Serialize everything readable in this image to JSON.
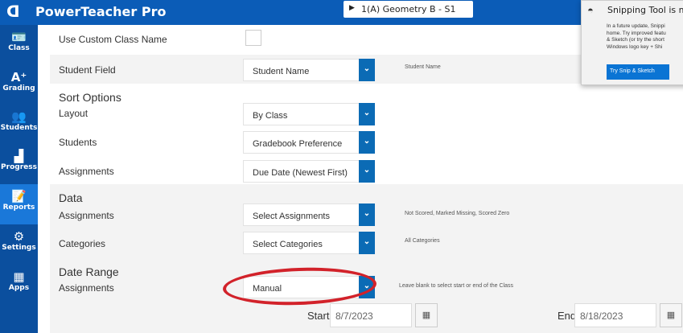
{
  "header": {
    "app_title": "PowerTeacher Pro",
    "class_selector": "1(A) Geometry B - S1"
  },
  "sidebar": {
    "items": [
      {
        "label": "Class",
        "icon": "class-card-icon"
      },
      {
        "label": "Grading",
        "icon": "a-plus-icon"
      },
      {
        "label": "Students",
        "icon": "students-icon"
      },
      {
        "label": "Progress",
        "icon": "bar-chart-icon"
      },
      {
        "label": "Reports",
        "icon": "report-icon",
        "active": true
      },
      {
        "label": "Settings",
        "icon": "gear-icon"
      },
      {
        "label": "Apps",
        "icon": "grid-icon"
      }
    ]
  },
  "form": {
    "custom_class_name": {
      "label": "Use Custom Class Name",
      "checked": false
    },
    "student_field": {
      "label": "Student Field",
      "value": "Student Name",
      "note": "Student Name"
    },
    "sort_options": {
      "title": "Sort Options",
      "layout": {
        "label": "Layout",
        "value": "By Class"
      },
      "students": {
        "label": "Students",
        "value": "Gradebook Preference"
      },
      "assignments": {
        "label": "Assignments",
        "value": "Due Date (Newest First)"
      }
    },
    "data": {
      "title": "Data",
      "assignments": {
        "label": "Assignments",
        "value": "Select Assignments",
        "note": "Not Scored, Marked Missing, Scored Zero"
      },
      "categories": {
        "label": "Categories",
        "value": "Select Categories",
        "note": "All Categories"
      }
    },
    "date_range": {
      "title": "Date Range",
      "assignments": {
        "label": "Assignments",
        "value": "Manual",
        "note": "Leave blank to select start or end of the Class"
      },
      "start_label": "Start",
      "start": "8/7/2023",
      "end_label": "End",
      "end": "8/18/2023"
    }
  },
  "toast": {
    "title": "Snipping Tool is mo",
    "body": "In a future update, Snippi\nhome. Try improved featu\n& Sketch (or try the short\nWindows logo key + Shi",
    "button": "Try Snip & Sketch"
  },
  "colors": {
    "header": "#0b5cb7",
    "sidebar": "#0b4f9e",
    "active": "#1a78d9",
    "annotation": "#d2222a"
  }
}
